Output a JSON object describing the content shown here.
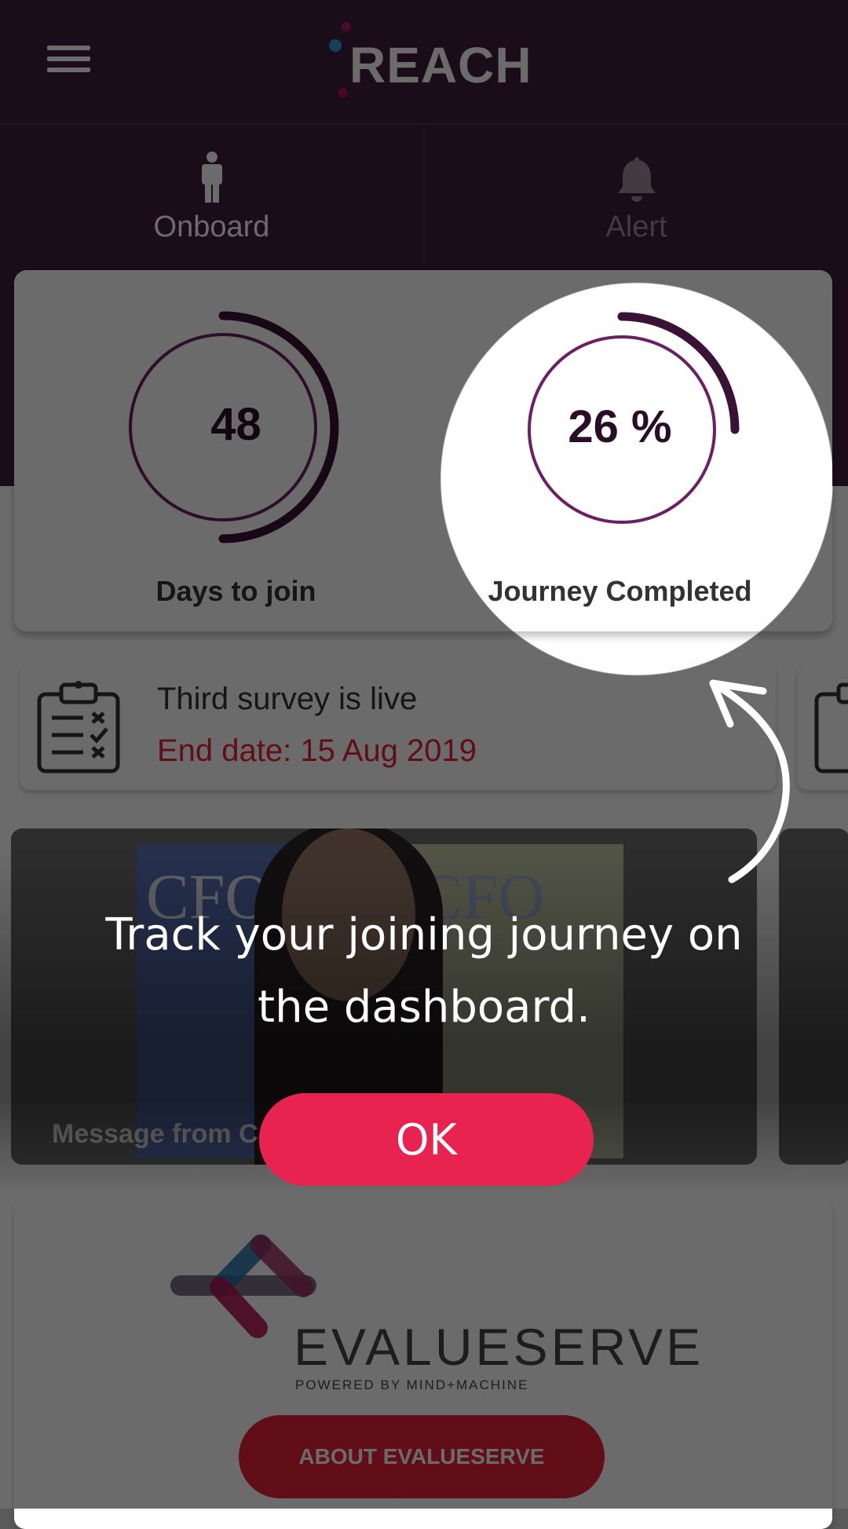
{
  "app": {
    "title": "REACH",
    "menu_icon": "hamburger-menu-icon"
  },
  "tabs": [
    {
      "label": "Onboard",
      "icon": "person-icon",
      "active": true
    },
    {
      "label": "Alert",
      "icon": "bell-icon",
      "active": false
    }
  ],
  "stats": {
    "days_to_join": {
      "value": "48",
      "label": "Days to join"
    },
    "journey": {
      "value": "26 %",
      "label": "Journey Completed",
      "progress": 0.26
    }
  },
  "survey": {
    "title": "Third survey is live",
    "end_date": "End date: 15 Aug 2019",
    "icon": "clipboard-checklist-icon"
  },
  "media": {
    "caption": "Message from C",
    "magazine_text_left": "CFO",
    "magazine_text_right": "CFO"
  },
  "brand": {
    "name": "EVALUESERVE",
    "tagline": "POWERED BY MIND+MACHINE",
    "about_button": "ABOUT EVALUESERVE"
  },
  "coach": {
    "message_line1": "Track your joining journey on",
    "message_line2": "the dashboard.",
    "ok_label": "OK"
  },
  "colors": {
    "brand_purple": "#3e1e3b",
    "accent_red": "#e8203a",
    "ok_pink": "#e8234f"
  }
}
